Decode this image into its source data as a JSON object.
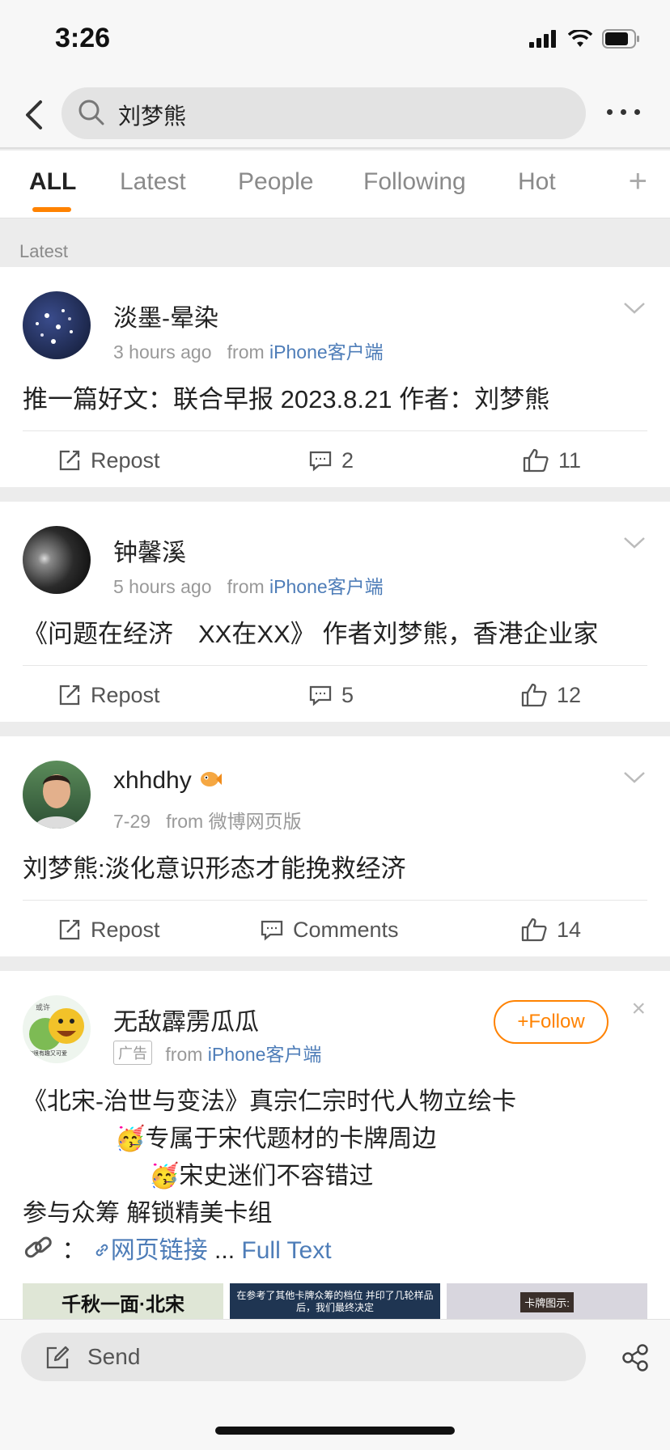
{
  "status": {
    "time": "3:26"
  },
  "search": {
    "query": "刘梦熊"
  },
  "tabs": [
    "ALL",
    "Latest",
    "People",
    "Following",
    "Hot"
  ],
  "section_label": "Latest",
  "posts": [
    {
      "name": "淡墨-晕染",
      "time": "3 hours ago",
      "from": "from",
      "source": "iPhone客户端",
      "text": "推一篇好文：联合早报 2023.8.21 作者：刘梦熊",
      "repost": "Repost",
      "comments": "2",
      "likes": "11"
    },
    {
      "name": "钟馨溪",
      "time": "5 hours ago",
      "from": "from",
      "source": "iPhone客户端",
      "text": "《问题在经济　XX在XX》 作者刘梦熊，香港企业家",
      "repost": "Repost",
      "comments": "5",
      "likes": "12"
    },
    {
      "name": "xhhdhy",
      "time": "7-29",
      "from": "from",
      "source": "微博网页版",
      "text": "刘梦熊:淡化意识形态才能挽救经济",
      "repost": "Repost",
      "comments": "Comments",
      "likes": "14"
    }
  ],
  "ad": {
    "name": "无敌霹雳瓜瓜",
    "badge": "广告",
    "from": "from",
    "source": "iPhone客户端",
    "follow": "+Follow",
    "close": "×",
    "line1": "《北宋-治世与变法》真宗仁宗时代人物立绘卡",
    "line2": "专属于宋代题材的卡牌周边",
    "line3": "宋史迷们不容错过",
    "line4": "参与众筹  解锁精美卡组",
    "link_prefix": "：",
    "link": "网页链接",
    "ellipsis": "...",
    "full_text": "Full Text",
    "avatar_text1": "或许",
    "avatar_text2": "你很有趣又可爱",
    "thumb1": "千秋一面·北宋",
    "thumb2": "在参考了其他卡牌众筹的档位 并印了几轮样品后，我们最终决定",
    "thumb3": "卡牌图示:"
  },
  "bottom": {
    "send": "Send"
  },
  "colors": {
    "accent": "#ff8200",
    "link": "#4e7db8"
  }
}
